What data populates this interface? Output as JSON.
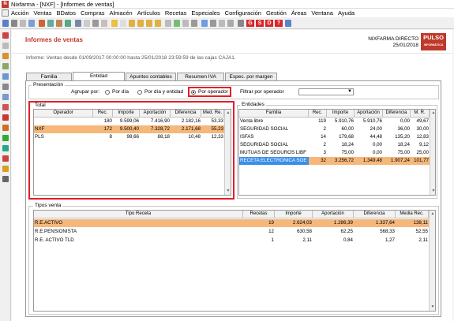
{
  "window": {
    "title": "Nixfarma - [NXF] - [Informes de ventas]"
  },
  "menu": [
    "Acción",
    "Ventas",
    "BDatos",
    "Compras",
    "Almacén",
    "Artículos",
    "Recetas",
    "Especiales",
    "Configuración",
    "Gestión",
    "Áreas",
    "Ventana",
    "Ayuda"
  ],
  "toolbar_red": [
    "G",
    "S",
    "D"
  ],
  "header": {
    "title": "Informes de ventas",
    "company": "NIXFARMA DIRECTO",
    "date": "25/01/2018",
    "logo": "PULSO",
    "logo_sub": "INFORMÁTICA"
  },
  "info": "Informe:  Ventas desde 01/09/2017 00:00:00 hasta 25/01/2018 23:59:59 de las cajas CAJA1.",
  "tabs": [
    "Familia",
    "Entidad",
    "Apuntes contables",
    "Resumen IVA",
    "Espec. por margen"
  ],
  "presentacion": {
    "title": "Presentación",
    "agrupar_label": "Agrupar por:",
    "options": [
      "Por día",
      "Por día y entidad",
      "Por operador"
    ],
    "selected": 2,
    "filtrar_label": "Filtrar por operador",
    "filtrar_value": ""
  },
  "total": {
    "title": "Total",
    "columns": [
      "Operador",
      "Rec.",
      "Importe",
      "Aportación",
      "Diferencia",
      "Med. Re."
    ],
    "rows": [
      {
        "operador": "",
        "rec": "180",
        "importe": "9.599,06",
        "aportacion": "7.416,90",
        "diferencia": "2.182,16",
        "med": "53,33"
      },
      {
        "operador": "NXF",
        "rec": "172",
        "importe": "9.500,40",
        "aportacion": "7.328,72",
        "diferencia": "2.171,68",
        "med": "55,23"
      },
      {
        "operador": "PLS",
        "rec": "8",
        "importe": "98,66",
        "aportacion": "88,18",
        "diferencia": "10,48",
        "med": "12,33"
      }
    ]
  },
  "entidades": {
    "title": "Entidades",
    "columns": [
      "Familia",
      "Rec.",
      "Importe",
      "Aportación",
      "Diferencia",
      "M. R."
    ],
    "rows": [
      {
        "familia": "Venta libre",
        "rec": "119",
        "importe": "5.910,76",
        "aportacion": "5.910,76",
        "diferencia": "0,00",
        "mr": "49,67"
      },
      {
        "familia": "SEGURIDAD SOCIAL",
        "rec": "2",
        "importe": "60,00",
        "aportacion": "24,00",
        "diferencia": "36,00",
        "mr": "30,00"
      },
      {
        "familia": "ISFAS",
        "rec": "14",
        "importe": "179,68",
        "aportacion": "44,48",
        "diferencia": "135,20",
        "mr": "12,83"
      },
      {
        "familia": "SEGURIDAD SOCIAL",
        "rec": "2",
        "importe": "18,24",
        "aportacion": "0,00",
        "diferencia": "18,24",
        "mr": "9,12"
      },
      {
        "familia": "MUTUAS DE SEGUROS LIBF",
        "rec": "3",
        "importe": "75,00",
        "aportacion": "0,00",
        "diferencia": "75,00",
        "mr": "25,00"
      },
      {
        "familia": "RECETA ELECTRONICA SOE",
        "rec": "32",
        "importe": "3.256,72",
        "aportacion": "1.349,48",
        "diferencia": "1.907,24",
        "mr": "101,77"
      }
    ]
  },
  "tipos": {
    "title": "Tipos venta",
    "columns": [
      "Tipo Receta",
      "Recetas",
      "Importe",
      "Aportación",
      "Diferencia",
      "Media Rec."
    ],
    "rows": [
      {
        "tipo": "R.E.ACTIVO",
        "recetas": "19",
        "importe": "2.624,03",
        "aportacion": "1.286,39",
        "diferencia": "1.337,64",
        "media": "138,11"
      },
      {
        "tipo": "R.E.PENSIONISTA",
        "recetas": "12",
        "importe": "630,58",
        "aportacion": "62,25",
        "diferencia": "568,33",
        "media": "52,55"
      },
      {
        "tipo": "R.E. ACTIVO TLD",
        "recetas": "1",
        "importe": "2,11",
        "aportacion": "0,84",
        "diferencia": "1,27",
        "media": "2,11"
      }
    ]
  }
}
